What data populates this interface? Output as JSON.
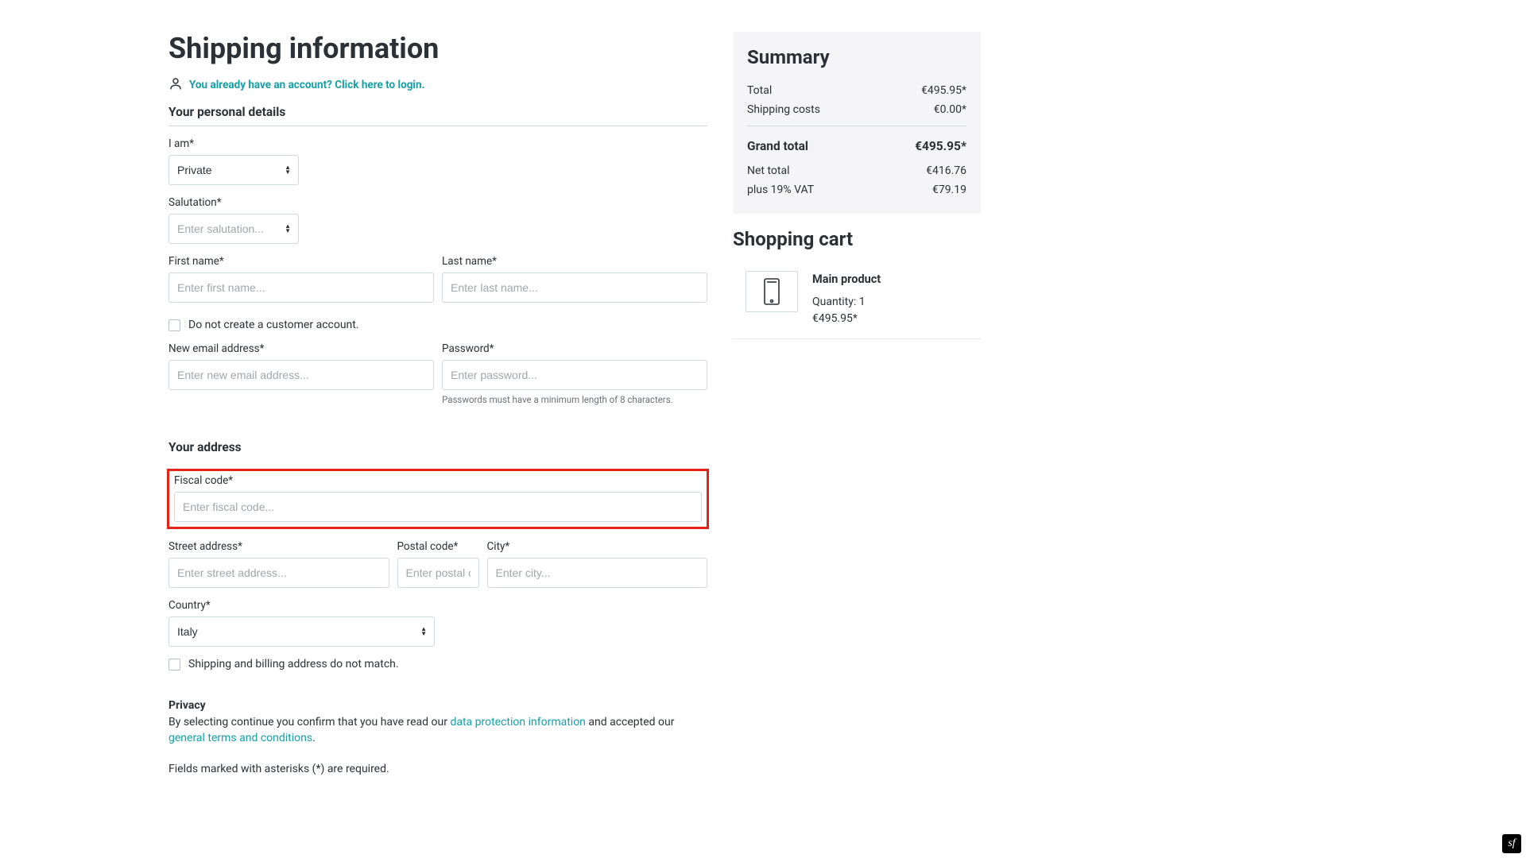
{
  "page": {
    "title": "Shipping information",
    "login_prompt": "You already have an account? Click here to login."
  },
  "personal": {
    "heading": "Your personal details",
    "iam_label": "I am*",
    "iam_value": "Private",
    "salutation_label": "Salutation*",
    "salutation_placeholder": "Enter salutation...",
    "first_label": "First name*",
    "first_placeholder": "Enter first name...",
    "last_label": "Last name*",
    "last_placeholder": "Enter last name...",
    "no_account_label": "Do not create a customer account.",
    "email_label": "New email address*",
    "email_placeholder": "Enter new email address...",
    "password_label": "Password*",
    "password_placeholder": "Enter password...",
    "password_helper": "Passwords must have a minimum length of 8 characters."
  },
  "address": {
    "heading": "Your address",
    "fiscal_label": "Fiscal code*",
    "fiscal_placeholder": "Enter fiscal code...",
    "street_label": "Street address*",
    "street_placeholder": "Enter street address...",
    "postal_label": "Postal code*",
    "postal_placeholder": "Enter postal code...",
    "city_label": "City*",
    "city_placeholder": "Enter city...",
    "country_label": "Country*",
    "country_value": "Italy",
    "billing_label": "Shipping and billing address do not match."
  },
  "privacy": {
    "heading": "Privacy",
    "prefix": "By selecting continue you confirm that you have read our ",
    "link1": "data protection information",
    "mid": " and accepted our ",
    "link2": "general terms and conditions",
    "suffix": ".",
    "required_note": "Fields marked with asterisks (*) are required."
  },
  "summary": {
    "heading": "Summary",
    "total_label": "Total",
    "total_value": "€495.95*",
    "shipping_label": "Shipping costs",
    "shipping_value": "€0.00*",
    "grand_label": "Grand total",
    "grand_value": "€495.95*",
    "net_label": "Net total",
    "net_value": "€416.76",
    "vat_label": "plus 19% VAT",
    "vat_value": "€79.19"
  },
  "cart": {
    "heading": "Shopping cart",
    "item": {
      "name": "Main product",
      "qty": "Quantity: 1",
      "price": "€495.95*"
    }
  }
}
